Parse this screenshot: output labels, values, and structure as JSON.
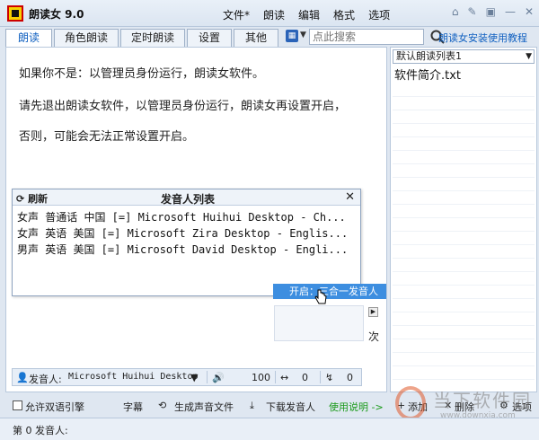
{
  "titlebar": {
    "title": "朗读女 9.0",
    "menu": [
      "文件*",
      "朗读",
      "编辑",
      "格式",
      "选项"
    ],
    "window_buttons": [
      "home-icon",
      "wrench-icon",
      "skin-icon",
      "minimize-icon",
      "close-icon"
    ]
  },
  "tabs": [
    {
      "label": "朗读",
      "active": true
    },
    {
      "label": "角色朗读",
      "active": false
    },
    {
      "label": "定时朗读",
      "active": false
    },
    {
      "label": "设置",
      "active": false
    },
    {
      "label": "其他",
      "active": false
    }
  ],
  "search": {
    "placeholder": "点此搜索",
    "guide_link": "朗读女安装使用教程"
  },
  "main": {
    "lines": [
      "如果你不是：以管理员身份运行，朗读女软件。",
      "请先退出朗读女软件，以管理员身份运行，朗读女再设置开启，",
      "否则，可能会无法正常设置开启。"
    ]
  },
  "right_panel": {
    "list_name": "默认朗读列表1",
    "items": [
      "软件简介.txt"
    ]
  },
  "voice_popup": {
    "refresh_label": "刷新",
    "title": "发音人列表",
    "voices": [
      "女声 普通话 中国 [=] Microsoft Huihui Desktop - Ch...",
      "女声 英语 美国 [=] Microsoft Zira Desktop - Englis...",
      "男声 英语 美国 [=] Microsoft David Desktop - Engli..."
    ]
  },
  "context_item": "开启：三合一发音人",
  "next_label": "次",
  "voice_bar": {
    "voice_label": "发音人:",
    "voice_value": "Microsoft Huihui Desktop",
    "volume": "100",
    "speed": "0",
    "pitch": "0"
  },
  "toolbar2": {
    "bilingual": "允许双语引擎",
    "subtitle": "字幕",
    "gen_audio": "生成声音文件",
    "download_voice": "下载发音人",
    "help": "使用说明 ->",
    "add": "添加",
    "delete": "删除",
    "options": "选项"
  },
  "status": {
    "text": "第 0 发音人:"
  },
  "watermark": {
    "text": "当下软件园",
    "sub": "www.downxia.com"
  }
}
